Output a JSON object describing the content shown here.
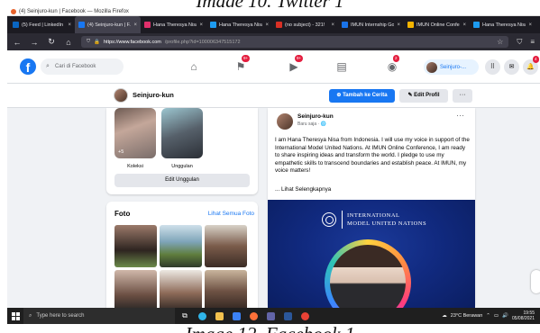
{
  "captions": {
    "top": "Image 10. Twitter 1",
    "bottom": "Image 12. Facebook 1"
  },
  "browser": {
    "window_title": "(4) Seinjuro-kun | Facebook — Mozilla Firefox",
    "tabs": [
      {
        "label": "(5) Feed | LinkedIn",
        "icon_color": "#0a66c2",
        "active": false
      },
      {
        "label": "(4) Seinjuro-kun | F...",
        "icon_color": "#1877f2",
        "active": true
      },
      {
        "label": "Hana Theresya Nisa",
        "icon_color": "#e1306c",
        "active": false
      },
      {
        "label": "Hana Theresya Nisa",
        "icon_color": "#1d9bf0",
        "active": false
      },
      {
        "label": "(no subject) - 321!",
        "icon_color": "#d93025",
        "active": false
      },
      {
        "label": "IMUN Internship Go",
        "icon_color": "#1a73e8",
        "active": false
      },
      {
        "label": "IMUN Online Confe",
        "icon_color": "#f4b400",
        "active": false
      },
      {
        "label": "Hana Theresya Nisa",
        "icon_color": "#1d9bf0",
        "active": false
      }
    ],
    "url_host": "https://www.facebook.com",
    "url_rest": "/profile.php?id=100006347515172",
    "nav": {
      "back": "←",
      "forward": "→",
      "reload": "↻",
      "home": "⌂"
    }
  },
  "facebook": {
    "logo": "f",
    "search_placeholder": "Cari di Facebook",
    "badges": {
      "notifications_watch": "9+",
      "notifications_flag": "9+",
      "notifications_groups": "2",
      "notifications_bell": "4"
    },
    "profile_chip_name": "Seinjuro-...",
    "profile_name": "Seinjuro-kun",
    "story_button": "Tambah ke Cerita",
    "edit_profile_button": "Edit Profil",
    "more_button": "···",
    "highlights": {
      "count": "+5",
      "label_1": "Koleksi",
      "label_2": "Unggulan",
      "edit_button": "Edit Unggulan"
    },
    "photos": {
      "title": "Foto",
      "see_all": "Lihat Semua Foto"
    },
    "post": {
      "author": "Seinjuro-kun",
      "time": "Baru saja · 🌐",
      "more": "···",
      "text": "I am Hana Theresya Nisa from Indonesia. I will use my voice in support of the International Model United Nations. At IMUN Online Conference, I am ready to share inspiring ideas and transform the world. I pledge to use my empathetic skills to transcend boundaries and establish peace. At IMUN, my voice matters!",
      "read_more": "... Lihat Selengkapnya",
      "image_title_line1": "INTERNATIONAL",
      "image_title_line2": "MODEL UNITED NATIONS"
    }
  },
  "taskbar": {
    "search_placeholder": "Type here to search",
    "weather": "23°C Berawan",
    "time": "19:55",
    "date": "05/08/2021"
  }
}
